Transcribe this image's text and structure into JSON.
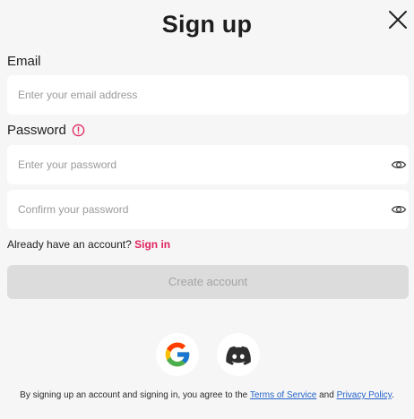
{
  "header": {
    "title": "Sign up"
  },
  "form": {
    "email_label": "Email",
    "email_placeholder": "Enter your email address",
    "password_label": "Password",
    "password_placeholder": "Enter your password",
    "confirm_placeholder": "Confirm your password"
  },
  "account": {
    "prompt": "Already have an account?",
    "signin_label": "Sign in"
  },
  "actions": {
    "create_label": "Create account"
  },
  "social": {
    "providers": [
      "google-icon",
      "discord-icon"
    ]
  },
  "terms": {
    "prefix": "By signing up an account and signing in, you agree to the",
    "terms_link": "Terms of Service",
    "conjunction": "and",
    "privacy_link": "Privacy Policy",
    "suffix": "."
  },
  "colors": {
    "background": "#f6f6f6",
    "accent": "#e0245e",
    "link": "#2563c9",
    "discord": "#5865f2"
  }
}
